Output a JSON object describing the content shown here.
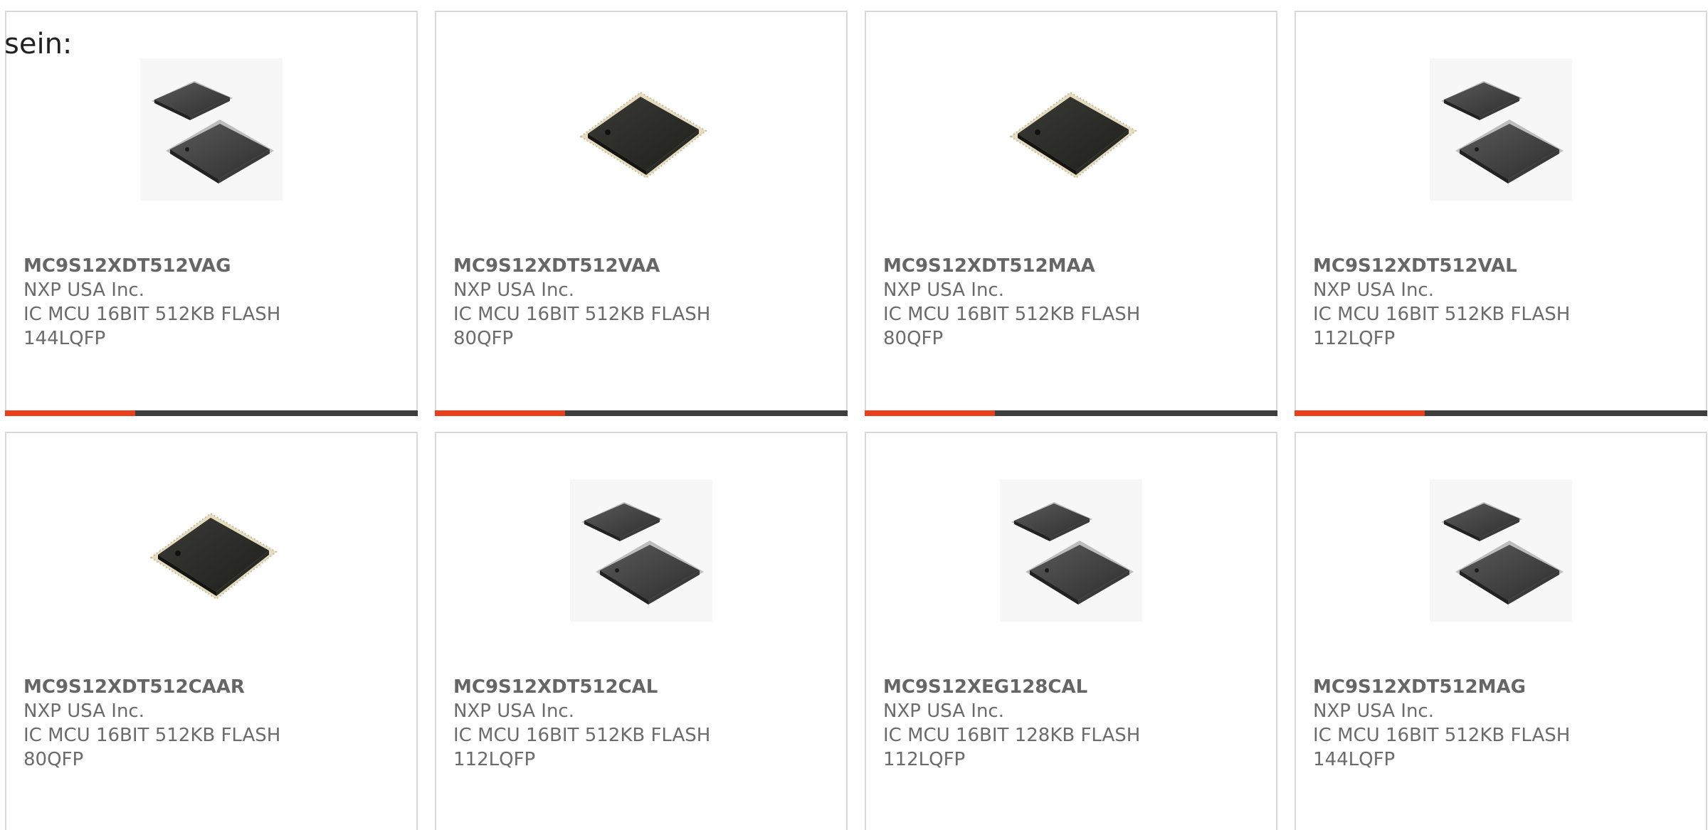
{
  "intro_text": "sein:",
  "colors": {
    "accent": "#e8401c",
    "bar_track": "#3d3d3d",
    "border": "#d9d9d9",
    "text": "#6b6b6b"
  },
  "products": [
    {
      "part_number": "MC9S12XDT512VAG",
      "manufacturer": "NXP USA Inc.",
      "description": "IC MCU 16BIT 512KB FLASH",
      "package": "144LQFP",
      "image": "lqfp-pair-icon",
      "show_bar": true
    },
    {
      "part_number": "MC9S12XDT512VAA",
      "manufacturer": "NXP USA Inc.",
      "description": "IC MCU 16BIT 512KB FLASH",
      "package": "80QFP",
      "image": "qfp-chip-icon",
      "show_bar": true
    },
    {
      "part_number": "MC9S12XDT512MAA",
      "manufacturer": "NXP USA Inc.",
      "description": "IC MCU 16BIT 512KB FLASH",
      "package": "80QFP",
      "image": "qfp-chip-icon",
      "show_bar": true
    },
    {
      "part_number": "MC9S12XDT512VAL",
      "manufacturer": "NXP USA Inc.",
      "description": "IC MCU 16BIT 512KB FLASH",
      "package": "112LQFP",
      "image": "lqfp-pair-icon",
      "show_bar": true
    },
    {
      "part_number": "MC9S12XDT512CAAR",
      "manufacturer": "NXP USA Inc.",
      "description": "IC MCU 16BIT 512KB FLASH",
      "package": "80QFP",
      "image": "qfp-chip-icon",
      "show_bar": false
    },
    {
      "part_number": "MC9S12XDT512CAL",
      "manufacturer": "NXP USA Inc.",
      "description": "IC MCU 16BIT 512KB FLASH",
      "package": "112LQFP",
      "image": "lqfp-pair-icon",
      "show_bar": false
    },
    {
      "part_number": "MC9S12XEG128CAL",
      "manufacturer": "NXP USA Inc.",
      "description": "IC MCU 16BIT 128KB FLASH",
      "package": "112LQFP",
      "image": "lqfp-pair-icon",
      "show_bar": false
    },
    {
      "part_number": "MC9S12XDT512MAG",
      "manufacturer": "NXP USA Inc.",
      "description": "IC MCU 16BIT 512KB FLASH",
      "package": "144LQFP",
      "image": "lqfp-pair-icon",
      "show_bar": false
    }
  ]
}
